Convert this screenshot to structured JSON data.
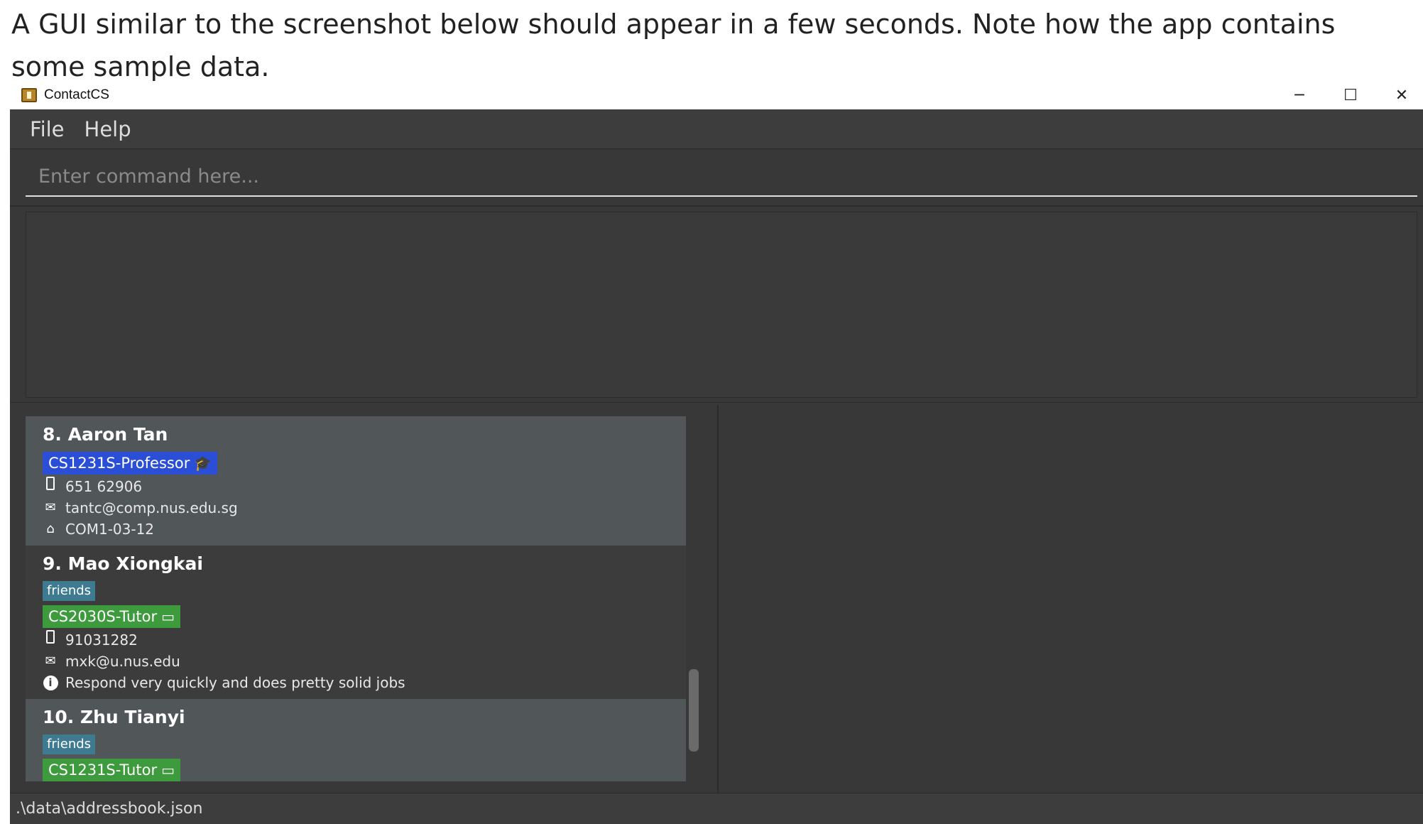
{
  "caption": "A GUI similar to the screenshot below should appear in a few seconds. Note how the app contains some sample data.",
  "window": {
    "title": "ContactCS",
    "controls": {
      "minimize": "─",
      "maximize": "☐",
      "close": "✕"
    }
  },
  "menu": {
    "file": "File",
    "help": "Help"
  },
  "command": {
    "placeholder": "Enter command here...",
    "value": ""
  },
  "result_text": "",
  "contacts": [
    {
      "name": "8. Aaron Tan",
      "tags": [],
      "role": "CS1231S-Professor",
      "role_type": "professor",
      "role_icon": "graduation-cap-icon",
      "phone": "651 62906",
      "email": "tantc@comp.nus.edu.sg",
      "address": "COM1-03-12",
      "remark": ""
    },
    {
      "name": "9. Mao Xiongkai",
      "tags": [
        "friends"
      ],
      "role": "CS2030S-Tutor",
      "role_type": "tutor",
      "role_icon": "chalkboard-teacher-icon",
      "phone": "91031282",
      "email": "mxk@u.nus.edu",
      "address": "",
      "remark": "Respond very quickly and does pretty solid jobs"
    },
    {
      "name": "10. Zhu Tianyi",
      "tags": [
        "friends"
      ],
      "role": "CS1231S-Tutor",
      "role_type": "tutor",
      "role_icon": "chalkboard-teacher-icon",
      "phone": "",
      "email": "",
      "address": "",
      "remark": ""
    }
  ],
  "status": {
    "path": ".\\data\\addressbook.json"
  },
  "colors": {
    "background": "#383838",
    "professor_role": "#2a4fd6",
    "tutor_role": "#3d9b3d",
    "tag": "#3e7b91",
    "card_light": "#515658"
  }
}
